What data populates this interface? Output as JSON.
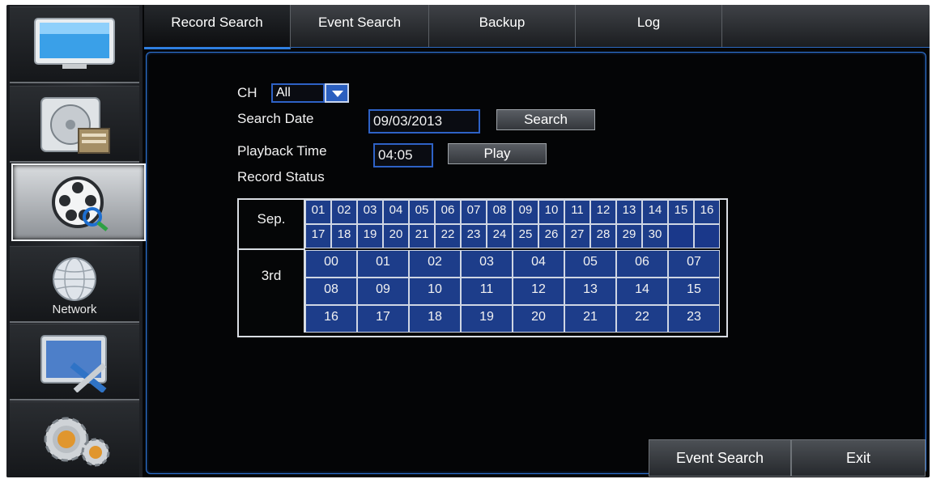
{
  "tabs": [
    "Record Search",
    "Event Search",
    "Backup",
    "Log"
  ],
  "sidebar": {
    "items": [
      {
        "icon": "monitor-icon",
        "label": ""
      },
      {
        "icon": "record-disk-icon",
        "label": ""
      },
      {
        "icon": "film-reel-search-icon",
        "label": ""
      },
      {
        "icon": "network-globe-icon",
        "label": "Network"
      },
      {
        "icon": "system-tools-icon",
        "label": ""
      },
      {
        "icon": "settings-gears-icon",
        "label": ""
      }
    ]
  },
  "form": {
    "ch_label": "CH",
    "ch_value": "All",
    "search_date_label": "Search Date",
    "search_date_value": "09/03/2013",
    "search_button": "Search",
    "playback_time_label": "Playback Time",
    "playback_time_value": "04:05",
    "play_button": "Play",
    "record_status_label": "Record Status"
  },
  "calendar": {
    "month": "Sep.",
    "day": "3rd",
    "dates_row1": [
      "01",
      "02",
      "03",
      "04",
      "05",
      "06",
      "07",
      "08",
      "09",
      "10",
      "11",
      "12",
      "13",
      "14",
      "15",
      "16"
    ],
    "dates_row2": [
      "17",
      "18",
      "19",
      "20",
      "21",
      "22",
      "23",
      "24",
      "25",
      "26",
      "27",
      "28",
      "29",
      "30",
      "",
      ""
    ],
    "hours_row1": [
      "00",
      "01",
      "02",
      "03",
      "04",
      "05",
      "06",
      "07"
    ],
    "hours_row2": [
      "08",
      "09",
      "10",
      "11",
      "12",
      "13",
      "14",
      "15"
    ],
    "hours_row3": [
      "16",
      "17",
      "18",
      "19",
      "20",
      "21",
      "22",
      "23"
    ]
  },
  "bottom": {
    "event_search_button": "Event Search",
    "exit_button": "Exit"
  }
}
